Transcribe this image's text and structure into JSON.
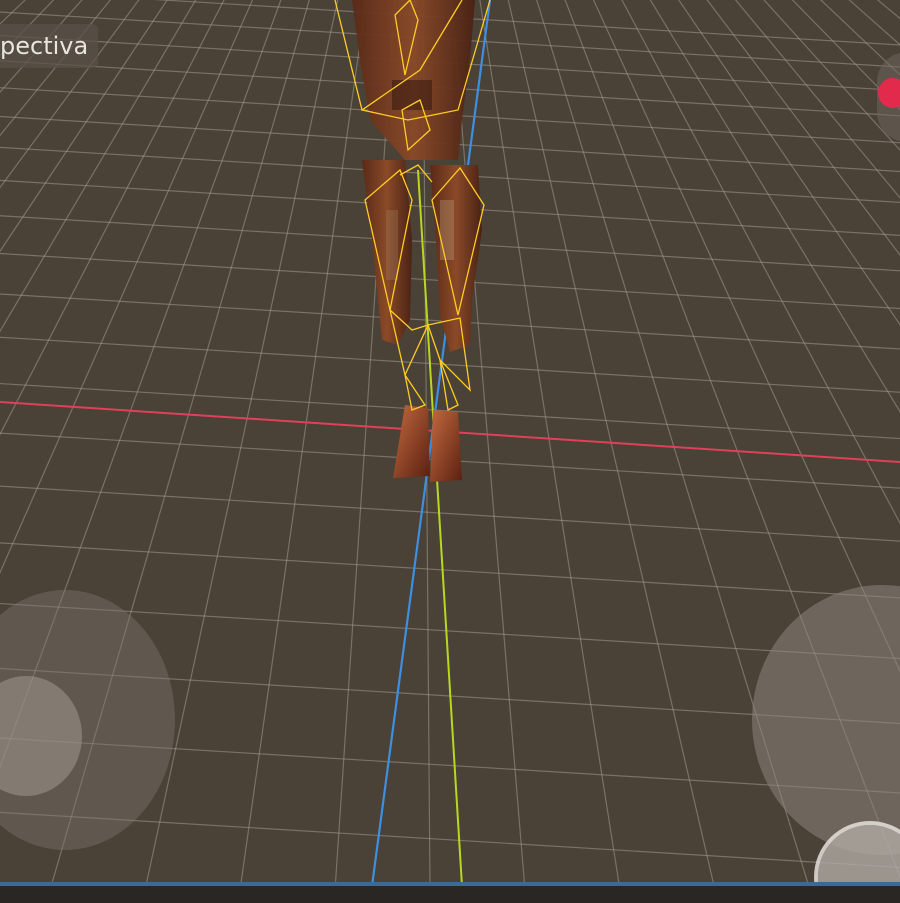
{
  "viewport": {
    "view_label": "pectiva",
    "background_color": "#4a4137",
    "axis_colors": {
      "x": "#e0405a",
      "y": "#b8d820",
      "z": "#3f8fe0"
    },
    "skeleton_color": "#ffcc22",
    "record_color": "#e22a4c"
  },
  "icons": {
    "record": "record-dot-icon"
  }
}
